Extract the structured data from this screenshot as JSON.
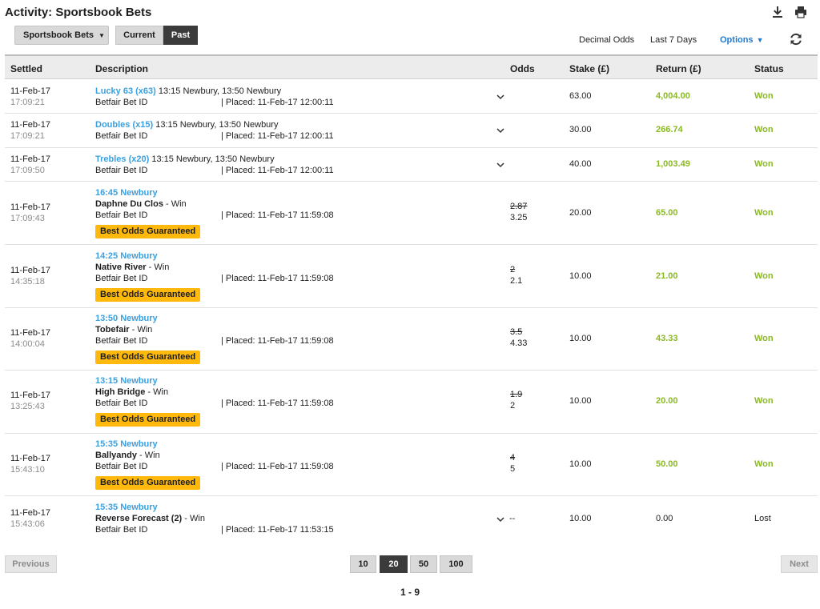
{
  "header": {
    "title": "Activity: Sportsbook Bets",
    "download_icon": "download-icon",
    "print_icon": "print-icon"
  },
  "toolbar": {
    "product_dropdown": "Sportsbook Bets",
    "tab_current": "Current",
    "tab_past": "Past",
    "odds_format": "Decimal Odds",
    "period": "Last 7 Days",
    "options": "Options",
    "refresh_icon": "refresh-icon"
  },
  "table": {
    "headers": {
      "settled": "Settled",
      "description": "Description",
      "odds": "Odds",
      "stake": "Stake (£)",
      "return": "Return (£)",
      "status": "Status"
    },
    "rows": [
      {
        "date": "11-Feb-17",
        "time": "17:09:21",
        "bet_type": "Lucky 63 (x63)",
        "legs": " 13:15 Newbury, 13:50 Newbury",
        "bet_id_label": "Betfair Bet ID",
        "placed": "| Placed: 11-Feb-17 12:00:11",
        "stake": "63.00",
        "return": "4,004.00",
        "status": "Won"
      },
      {
        "date": "11-Feb-17",
        "time": "17:09:21",
        "bet_type": "Doubles (x15)",
        "legs": " 13:15 Newbury, 13:50 Newbury",
        "bet_id_label": "Betfair Bet ID",
        "placed": "| Placed: 11-Feb-17 12:00:11",
        "stake": "30.00",
        "return": "266.74",
        "status": "Won"
      },
      {
        "date": "11-Feb-17",
        "time": "17:09:50",
        "bet_type": "Trebles (x20)",
        "legs": " 13:15 Newbury, 13:50 Newbury",
        "bet_id_label": "Betfair Bet ID",
        "placed": "| Placed: 11-Feb-17 12:00:11",
        "stake": "40.00",
        "return": "1,003.49",
        "status": "Won"
      },
      {
        "date": "11-Feb-17",
        "time": "17:09:43",
        "event": "16:45 Newbury",
        "selection": "Daphne Du Clos",
        "market": " - Win",
        "bet_id_label": "Betfair Bet ID",
        "placed": "| Placed: 11-Feb-17 11:59:08",
        "badge": "Best Odds Guaranteed",
        "odds_old": "2.87",
        "odds_new": "3.25",
        "stake": "20.00",
        "return": "65.00",
        "status": "Won"
      },
      {
        "date": "11-Feb-17",
        "time": "14:35:18",
        "event": "14:25 Newbury",
        "selection": "Native River",
        "market": " - Win",
        "bet_id_label": "Betfair Bet ID",
        "placed": "| Placed: 11-Feb-17 11:59:08",
        "badge": "Best Odds Guaranteed",
        "odds_old": "2",
        "odds_new": "2.1",
        "stake": "10.00",
        "return": "21.00",
        "status": "Won"
      },
      {
        "date": "11-Feb-17",
        "time": "14:00:04",
        "event": "13:50 Newbury",
        "selection": "Tobefair",
        "market": " - Win",
        "bet_id_label": "Betfair Bet ID",
        "placed": "| Placed: 11-Feb-17 11:59:08",
        "badge": "Best Odds Guaranteed",
        "odds_old": "3.5",
        "odds_new": "4.33",
        "stake": "10.00",
        "return": "43.33",
        "status": "Won"
      },
      {
        "date": "11-Feb-17",
        "time": "13:25:43",
        "event": "13:15 Newbury",
        "selection": "High Bridge",
        "market": " - Win",
        "bet_id_label": "Betfair Bet ID",
        "placed": "| Placed: 11-Feb-17 11:59:08",
        "badge": "Best Odds Guaranteed",
        "odds_old": "1.9",
        "odds_new": "2",
        "stake": "10.00",
        "return": "20.00",
        "status": "Won"
      },
      {
        "date": "11-Feb-17",
        "time": "15:43:10",
        "event": "15:35 Newbury",
        "selection": "Ballyandy",
        "market": " - Win",
        "bet_id_label": "Betfair Bet ID",
        "placed": "| Placed: 11-Feb-17 11:59:08",
        "badge": "Best Odds Guaranteed",
        "odds_old": "4",
        "odds_new": "5",
        "stake": "10.00",
        "return": "50.00",
        "status": "Won"
      },
      {
        "date": "11-Feb-17",
        "time": "15:43:06",
        "event": "15:35 Newbury",
        "selection": "Reverse Forecast (2)",
        "market": " - Win",
        "bet_id_label": "Betfair Bet ID",
        "placed": "| Placed: 11-Feb-17 11:53:15",
        "odds_dash": "--",
        "stake": "10.00",
        "return": "0.00",
        "status": "Lost"
      }
    ]
  },
  "pagination": {
    "previous": "Previous",
    "next": "Next",
    "page_sizes": [
      "10",
      "20",
      "50",
      "100"
    ],
    "active_page_size": "20",
    "range": "1 - 9"
  },
  "colors": {
    "accent_blue": "#3aa0e0",
    "won_green": "#8bb923",
    "badge_orange": "#ffb80c",
    "dark_button": "#3b3b3b"
  }
}
